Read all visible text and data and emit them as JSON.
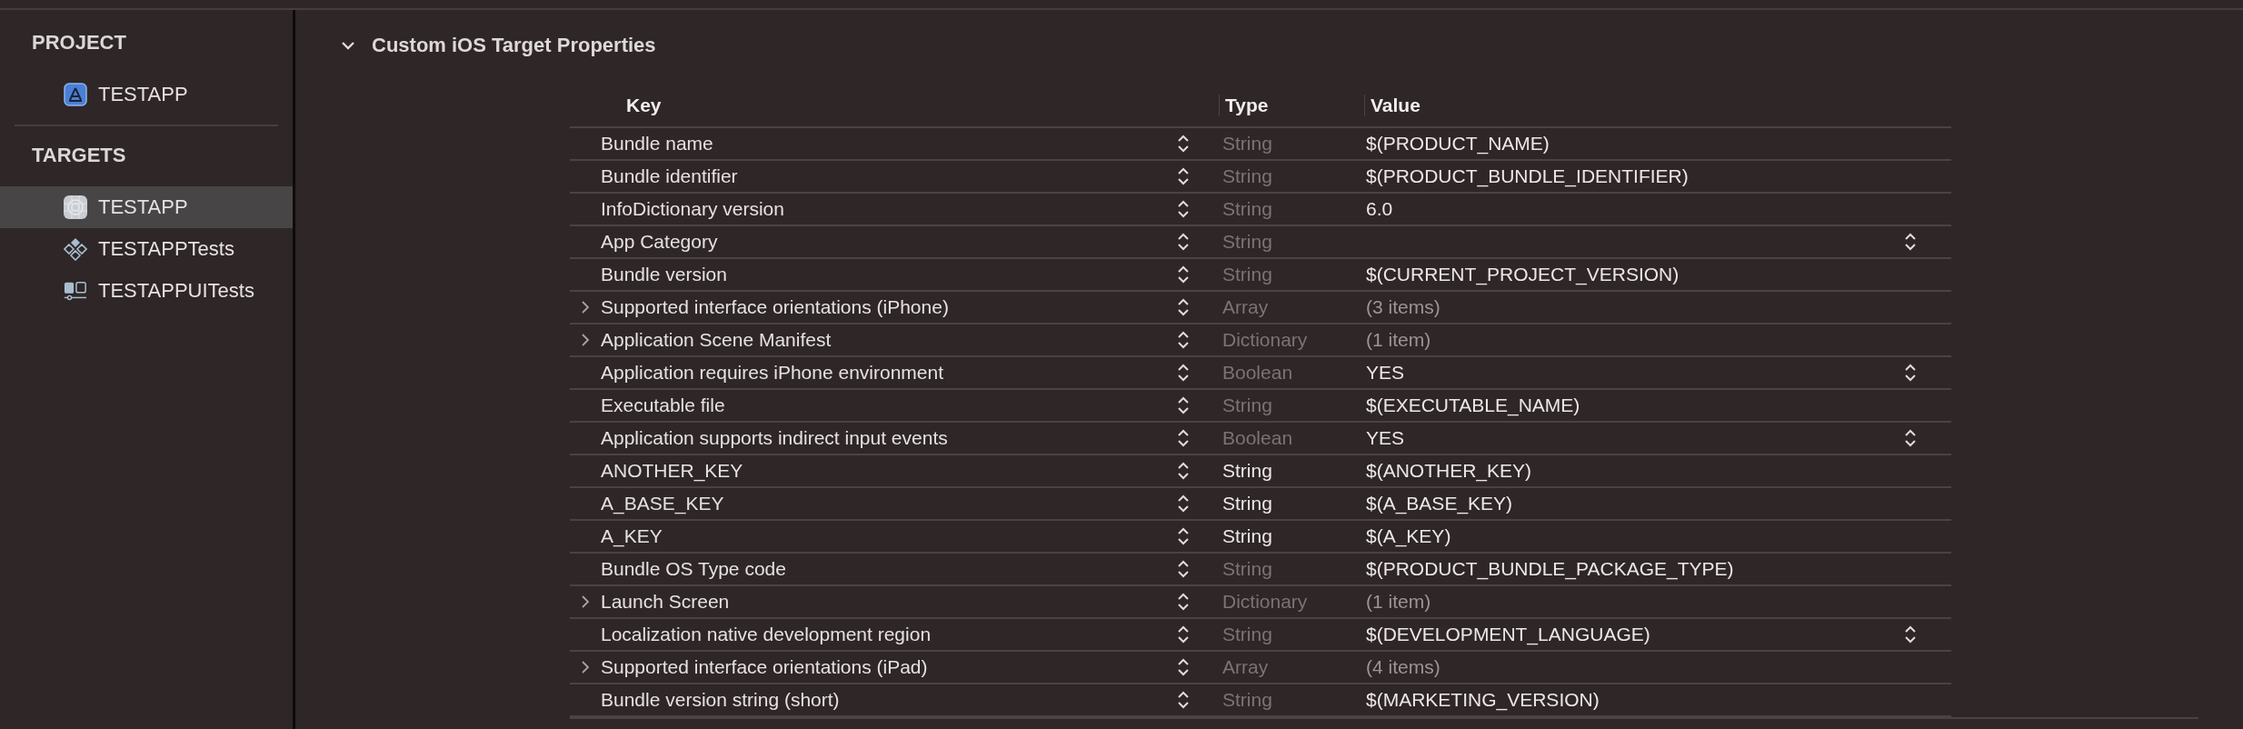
{
  "sidebar": {
    "sections": [
      {
        "title": "PROJECT",
        "items": [
          {
            "label": "TESTAPP",
            "kind": "project",
            "selected": false
          }
        ]
      },
      {
        "title": "TARGETS",
        "items": [
          {
            "label": "TESTAPP",
            "kind": "app",
            "selected": true
          },
          {
            "label": "TESTAPPTests",
            "kind": "tests",
            "selected": false
          },
          {
            "label": "TESTAPPUITests",
            "kind": "uitests",
            "selected": false
          }
        ]
      }
    ]
  },
  "section": {
    "title": "Custom iOS Target Properties",
    "expanded": true
  },
  "table": {
    "columns": [
      "Key",
      "Type",
      "Value"
    ],
    "rows": [
      {
        "key": "Bundle name",
        "type": "String",
        "value": "$(PRODUCT_NAME)",
        "type_dimmed": true,
        "value_dimmed": false,
        "popup": false
      },
      {
        "key": "Bundle identifier",
        "type": "String",
        "value": "$(PRODUCT_BUNDLE_IDENTIFIER)",
        "type_dimmed": true,
        "value_dimmed": false,
        "popup": false
      },
      {
        "key": "InfoDictionary version",
        "type": "String",
        "value": "6.0",
        "type_dimmed": true,
        "value_dimmed": false,
        "popup": false
      },
      {
        "key": "App Category",
        "type": "String",
        "type_dimmed": true,
        "popup": true
      },
      {
        "key": "Bundle version",
        "type": "String",
        "value": "$(CURRENT_PROJECT_VERSION)",
        "type_dimmed": true,
        "value_dimmed": false,
        "popup": false
      },
      {
        "key": "Supported interface orientations (iPhone)",
        "type": "Array",
        "value": "(3 items)",
        "type_dimmed": true,
        "value_dimmed": true,
        "popup": false,
        "expanded": false
      },
      {
        "key": "Application Scene Manifest",
        "type": "Dictionary",
        "value": "(1 item)",
        "type_dimmed": true,
        "value_dimmed": true,
        "popup": false,
        "expanded": false
      },
      {
        "key": "Application requires iPhone environment",
        "type": "Boolean",
        "value": "YES",
        "type_dimmed": true,
        "value_dimmed": false,
        "popup": true
      },
      {
        "key": "Executable file",
        "type": "String",
        "value": "$(EXECUTABLE_NAME)",
        "type_dimmed": true,
        "value_dimmed": false,
        "popup": false
      },
      {
        "key": "Application supports indirect input events",
        "type": "Boolean",
        "value": "YES",
        "type_dimmed": true,
        "value_dimmed": false,
        "popup": true
      },
      {
        "key": "ANOTHER_KEY",
        "type": "String",
        "value": "$(ANOTHER_KEY)",
        "type_dimmed": false,
        "value_dimmed": false,
        "popup": false
      },
      {
        "key": "A_BASE_KEY",
        "type": "String",
        "value": "$(A_BASE_KEY)",
        "type_dimmed": false,
        "value_dimmed": false,
        "popup": false
      },
      {
        "key": "A_KEY",
        "type": "String",
        "value": "$(A_KEY)",
        "type_dimmed": false,
        "value_dimmed": false,
        "popup": false
      },
      {
        "key": "Bundle OS Type code",
        "type": "String",
        "value": "$(PRODUCT_BUNDLE_PACKAGE_TYPE)",
        "type_dimmed": true,
        "value_dimmed": false,
        "popup": false
      },
      {
        "key": "Launch Screen",
        "type": "Dictionary",
        "value": "(1 item)",
        "type_dimmed": true,
        "value_dimmed": true,
        "popup": false,
        "expanded": false
      },
      {
        "key": "Localization native development region",
        "type": "String",
        "value": "$(DEVELOPMENT_LANGUAGE)",
        "type_dimmed": true,
        "value_dimmed": false,
        "popup": true
      },
      {
        "key": "Supported interface orientations (iPad)",
        "type": "Array",
        "value": "(4 items)",
        "type_dimmed": true,
        "value_dimmed": true,
        "popup": false,
        "expanded": false
      },
      {
        "key": "Bundle version string (short)",
        "type": "String",
        "value": "$(MARKETING_VERSION)",
        "type_dimmed": true,
        "value_dimmed": false,
        "popup": false
      }
    ]
  }
}
